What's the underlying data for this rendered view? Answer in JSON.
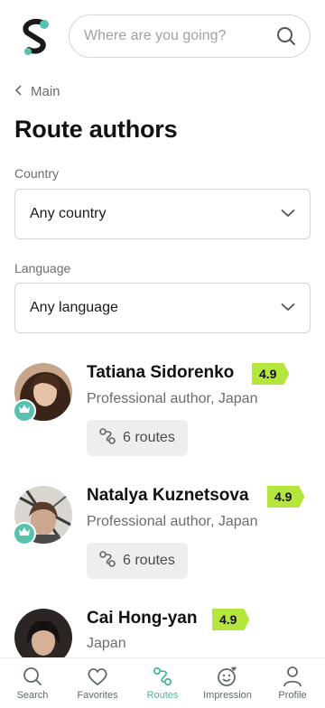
{
  "search": {
    "placeholder": "Where are you going?"
  },
  "nav": {
    "back_label": "Main"
  },
  "page": {
    "title": "Route authors"
  },
  "filters": {
    "country": {
      "label": "Country",
      "value": "Any country"
    },
    "language": {
      "label": "Language",
      "value": "Any language"
    }
  },
  "authors": [
    {
      "name": "Tatiana Sidorenko",
      "rating": "4.9",
      "description": "Professional author, Japan",
      "routes": "6 routes"
    },
    {
      "name": "Natalya Kuznetsova",
      "rating": "4.9",
      "description": "Professional author, Japan",
      "routes": "6 routes"
    },
    {
      "name": "Cai Hong-yan",
      "rating": "4.9",
      "description": "Japan"
    }
  ],
  "bottom_nav": [
    {
      "label": "Search",
      "icon": "search-icon"
    },
    {
      "label": "Favorites",
      "icon": "heart-icon"
    },
    {
      "label": "Routes",
      "icon": "route-icon",
      "active": true
    },
    {
      "label": "Impression",
      "icon": "smile-icon"
    },
    {
      "label": "Profile",
      "icon": "user-icon"
    }
  ],
  "colors": {
    "accent": "#57c2ad",
    "rating_bg": "#b4e63e",
    "text_muted": "#6c6c6c"
  }
}
